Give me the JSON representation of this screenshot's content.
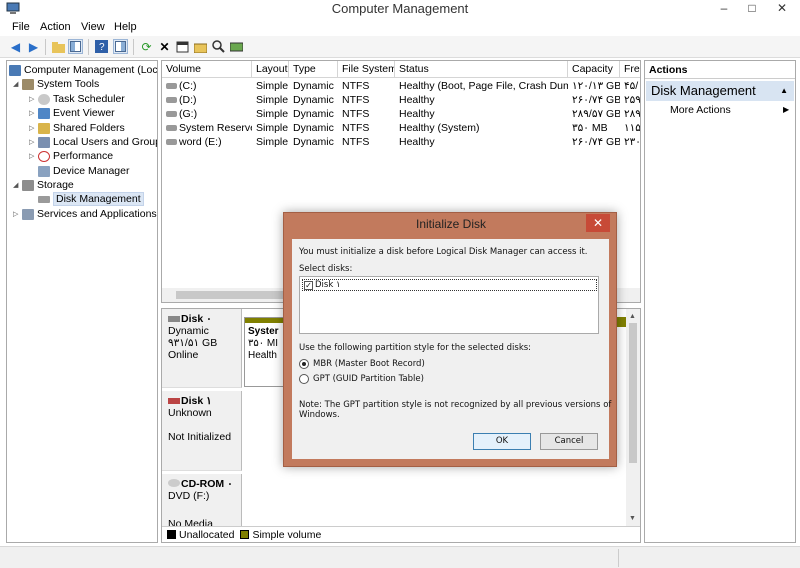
{
  "window": {
    "title": "Computer Management",
    "min": "–",
    "max": "□",
    "close": "✕"
  },
  "menu": [
    "File",
    "Action",
    "View",
    "Help"
  ],
  "tree": [
    {
      "label": "Computer Management (Local",
      "level": 0
    },
    {
      "label": "System Tools",
      "level": 1
    },
    {
      "label": "Task Scheduler",
      "level": 2
    },
    {
      "label": "Event Viewer",
      "level": 2
    },
    {
      "label": "Shared Folders",
      "level": 2
    },
    {
      "label": "Local Users and Groups",
      "level": 2
    },
    {
      "label": "Performance",
      "level": 2
    },
    {
      "label": "Device Manager",
      "level": 2
    },
    {
      "label": "Storage",
      "level": 1
    },
    {
      "label": "Disk Management",
      "level": 2
    },
    {
      "label": "Services and Applications",
      "level": 1
    }
  ],
  "volumes": {
    "columns": [
      "Volume",
      "Layout",
      "Type",
      "File System",
      "Status",
      "Capacity",
      "Fre"
    ],
    "rows": [
      [
        "(C:)",
        "Simple",
        "Dynamic",
        "NTFS",
        "Healthy (Boot, Page File, Crash Dump)",
        "۱۲۰/۱۳ GB",
        "۴۵/"
      ],
      [
        "(D:)",
        "Simple",
        "Dynamic",
        "NTFS",
        "Healthy",
        "۲۶۰/۷۴ GB",
        "۲۵۹"
      ],
      [
        "(G:)",
        "Simple",
        "Dynamic",
        "NTFS",
        "Healthy",
        "۲۸۹/۵۷ GB",
        "۲۸۹"
      ],
      [
        "System Reserved",
        "Simple",
        "Dynamic",
        "NTFS",
        "Healthy (System)",
        "۳۵۰ MB",
        "۱۱۵ M"
      ],
      [
        "word  (E:)",
        "Simple",
        "Dynamic",
        "NTFS",
        "Healthy",
        "۲۶۰/۷۴ GB",
        "۲۳۰"
      ]
    ]
  },
  "disks": [
    {
      "name": "Disk ۰",
      "lines": [
        "Dynamic",
        "۹۳۱/۵۱ GB",
        "Online"
      ],
      "vol_name": "Syster",
      "vol_size": "۳۵۰ MI",
      "vol_status": "Health"
    },
    {
      "name": "Disk ۱",
      "lines": [
        "Unknown",
        "",
        "Not Initialized"
      ]
    },
    {
      "name": "CD-ROM ۰",
      "lines": [
        "DVD (F:)",
        "",
        "",
        "No Media"
      ]
    }
  ],
  "legend": {
    "unallocated": "Unallocated",
    "simple": "Simple volume"
  },
  "actions": {
    "header": "Actions",
    "section": "Disk Management",
    "more": "More Actions"
  },
  "dialog": {
    "title": "Initialize Disk",
    "intro": "You must initialize a disk before Logical Disk Manager can access it.",
    "select_label": "Select disks:",
    "disk_entry": "Disk ۱",
    "style_label": "Use the following partition style for the selected disks:",
    "mbr": "MBR (Master Boot Record)",
    "gpt": "GPT (GUID Partition Table)",
    "note1": "Note: The GPT partition style is not recognized by all previous versions of",
    "note2": "Windows.",
    "ok": "OK",
    "cancel": "Cancel"
  },
  "colors": {
    "simple_volume": "#808000",
    "unallocated": "#000000",
    "dialog_frame": "#c27a5d"
  }
}
